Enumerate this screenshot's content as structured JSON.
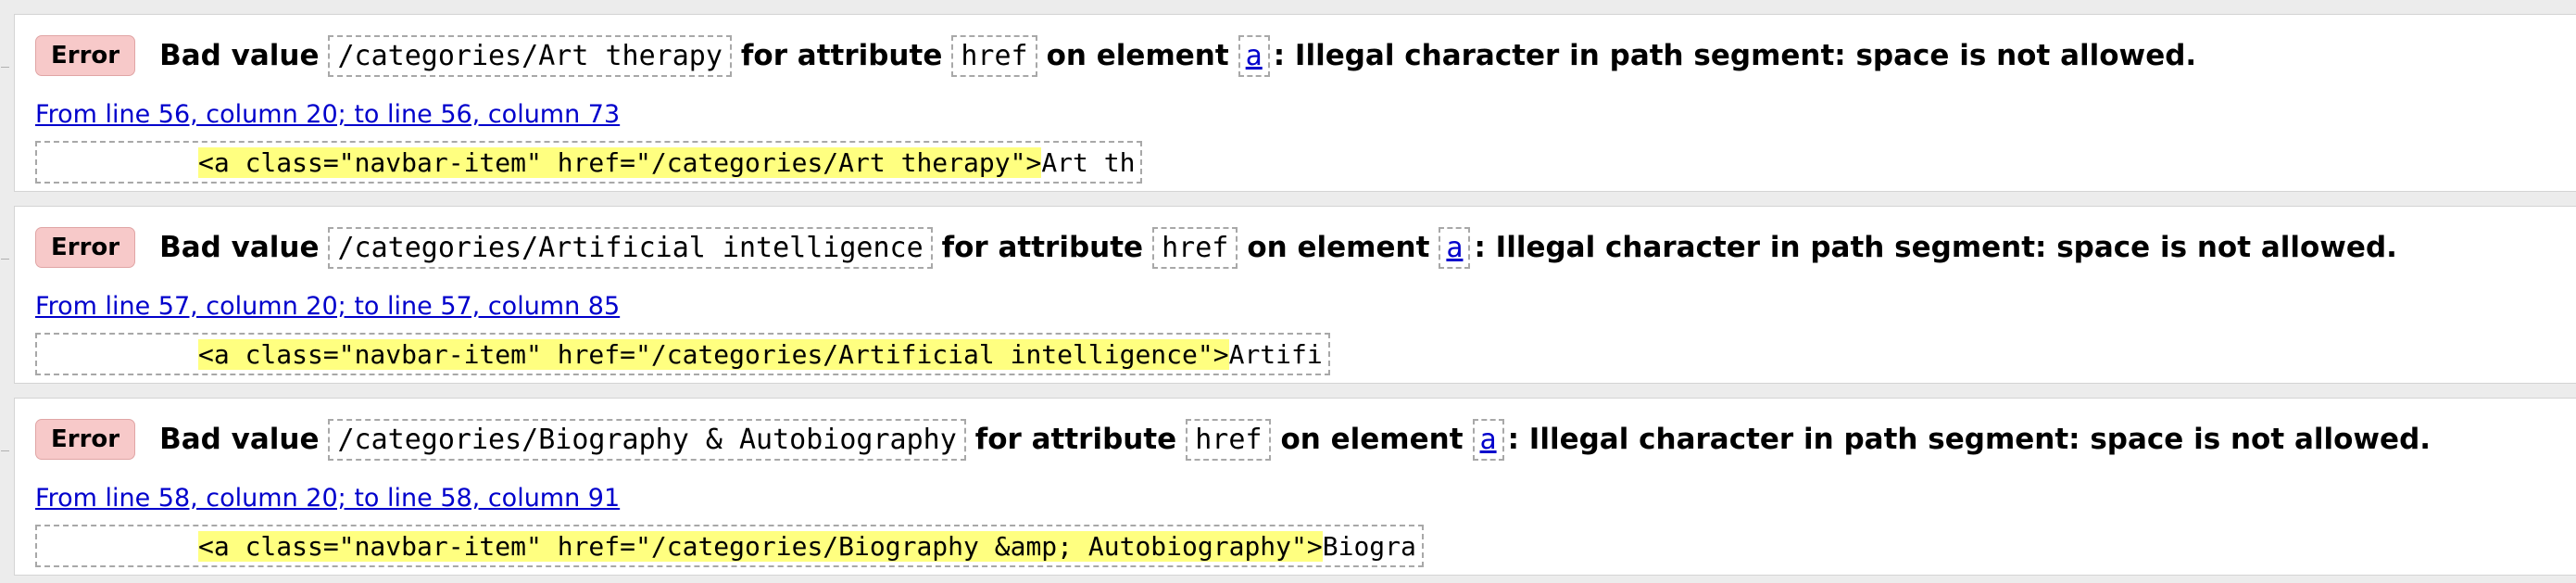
{
  "messages": [
    {
      "badge": "Error",
      "prefix": "Bad value",
      "value": "/categories/Art therapy",
      "mid1": "for attribute",
      "attribute": "href",
      "mid2": "on element",
      "element": "a",
      "suffix": ": Illegal character in path segment: space is not allowed.",
      "location": "From line 56, column 20; to line 56, column 73",
      "extract_highlight": "<a class=\"navbar-item\" href=\"/categories/Art therapy\">",
      "extract_tail": "Art th"
    },
    {
      "badge": "Error",
      "prefix": "Bad value",
      "value": "/categories/Artificial intelligence",
      "mid1": "for attribute",
      "attribute": "href",
      "mid2": "on element",
      "element": "a",
      "suffix": ": Illegal character in path segment: space is not allowed.",
      "location": "From line 57, column 20; to line 57, column 85",
      "extract_highlight": "<a class=\"navbar-item\" href=\"/categories/Artificial intelligence\">",
      "extract_tail": "Artifi"
    },
    {
      "badge": "Error",
      "prefix": "Bad value",
      "value": "/categories/Biography & Autobiography",
      "mid1": "for attribute",
      "attribute": "href",
      "mid2": "on element",
      "element": "a",
      "suffix": ": Illegal character in path segment: space is not allowed.",
      "location": "From line 58, column 20; to line 58, column 91",
      "extract_highlight": "<a class=\"navbar-item\" href=\"/categories/Biography &amp; Autobiography\">",
      "extract_tail": "Biogra"
    }
  ],
  "colors": {
    "badge_bg": "#f7c9c9",
    "link": "#0000cc",
    "highlight": "#ffff80",
    "panel_border": "#d4d4d4"
  }
}
